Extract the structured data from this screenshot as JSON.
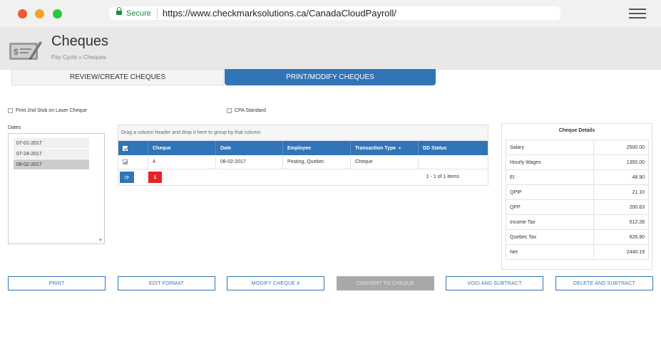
{
  "browser": {
    "secure_label": "Secure",
    "url": "https://www.checkmarksolutions.ca/CanadaCloudPayroll/"
  },
  "header": {
    "title": "Cheques",
    "breadcrumb": "Pay Cycle » Cheques"
  },
  "tabs": [
    {
      "label": "REVIEW/CREATE CHEQUES",
      "active": false
    },
    {
      "label": "PRINT/MODIFY CHEQUES",
      "active": true
    }
  ],
  "options": {
    "stub_label": "Print 2nd Stub on Laser Cheque",
    "cpa_label": "CPA Standard"
  },
  "dates": {
    "label": "Dates",
    "items": [
      "07-01-2017",
      "07-24-2017",
      "08-02-2017"
    ],
    "selected": "08-02-2017"
  },
  "grid": {
    "group_hint": "Drag a column header and drop it here to group by that column",
    "columns": [
      "Cheque",
      "Date",
      "Employee",
      "Transaction Type",
      "DD Status"
    ],
    "sort_indicator": "▲",
    "rows": [
      {
        "cheque": "4",
        "date": "08-02-2017",
        "employee": "Posting, Quebec",
        "transaction_type": "Cheque",
        "dd_status": ""
      }
    ],
    "refresh_symbol": "⟳",
    "current_page": "1",
    "pager_info": "1 - 1 of 1 items"
  },
  "details": {
    "title": "Cheque Details",
    "rows": [
      {
        "label": "Salary",
        "value": "2500.00"
      },
      {
        "label": "Hourly Wages",
        "value": "1350.00"
      },
      {
        "label": "EI",
        "value": "48.90"
      },
      {
        "label": "QPIP",
        "value": "21.10"
      },
      {
        "label": "QPP",
        "value": "200.63"
      },
      {
        "label": "Income Tax",
        "value": "512.28"
      },
      {
        "label": "Quebec Tax",
        "value": "626.90"
      },
      {
        "label": "Net",
        "value": "2440.19"
      }
    ]
  },
  "actions": {
    "print": "PRINT",
    "edit_format": "EDIT FORMAT",
    "modify_cheque": "MODIFY CHEQUE #",
    "convert": "CONVERT TO CHEQUE",
    "void": "VOID AND SUBTRACT",
    "delete": "DELETE AND SUBTRACT"
  },
  "colors": {
    "accent": "#3174b8",
    "danger": "#e8202a",
    "secure": "#1e8e3e"
  }
}
